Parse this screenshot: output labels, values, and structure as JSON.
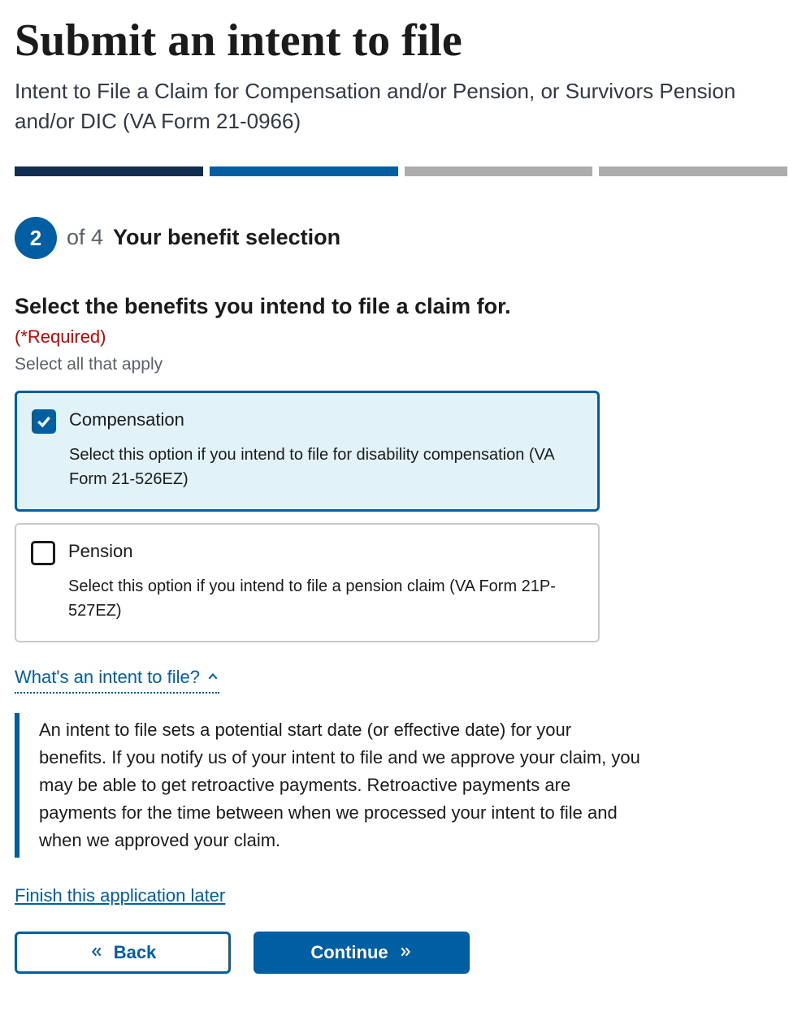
{
  "header": {
    "title": "Submit an intent to file",
    "subtitle": "Intent to File a Claim for Compensation and/or Pension, or Survivors Pension and/or DIC (VA Form 21-0966)"
  },
  "progress": {
    "segments": [
      "done",
      "current",
      "future",
      "future"
    ]
  },
  "step": {
    "current": "2",
    "of_label": "of 4",
    "title": "Your benefit selection"
  },
  "fieldset": {
    "legend": "Select the benefits you intend to file a claim for.",
    "required_label": "(*Required)",
    "hint": "Select all that apply"
  },
  "options": [
    {
      "id": "compensation",
      "title": "Compensation",
      "desc": "Select this option if you intend to file for disability compensation (VA Form 21-526EZ)",
      "checked": true
    },
    {
      "id": "pension",
      "title": "Pension",
      "desc": "Select this option if you intend to file a pension claim (VA Form 21P-527EZ)",
      "checked": false
    }
  ],
  "disclosure": {
    "toggle_label": "What's an intent to file?",
    "expanded": true,
    "body": "An intent to file sets a potential start date (or effective date) for your benefits. If you notify us of your intent to file and we approve your claim, you may be able to get retroactive payments. Retroactive payments are payments for the time between when we processed your intent to file and when we approved your claim."
  },
  "finish_later_label": "Finish this application later",
  "nav": {
    "back_label": "Back",
    "continue_label": "Continue"
  }
}
